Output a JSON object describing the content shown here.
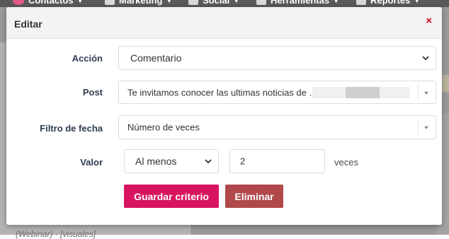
{
  "background": {
    "nav": {
      "items": [
        {
          "label": "Contactos",
          "icon": "contacts-icon"
        },
        {
          "label": "Marketing",
          "icon": "marketing-icon"
        },
        {
          "label": "Social",
          "icon": "chat-icon"
        },
        {
          "label": "Herramientas",
          "icon": "tools-icon"
        },
        {
          "label": "Reportes",
          "icon": "chart-icon"
        }
      ]
    },
    "left_text": "(Webinar) · [visuales]"
  },
  "modal": {
    "title": "Editar",
    "close_label": "×",
    "fields": {
      "accion": {
        "label": "Acción",
        "value": "Comentario"
      },
      "post": {
        "label": "Post",
        "value": "Te invitamos conocer las ultimas noticias de ."
      },
      "filtro": {
        "label": "Filtro de fecha",
        "value": "Número de veces"
      },
      "valor": {
        "label": "Valor",
        "operator": "Al menos",
        "amount": "2",
        "suffix": "veces"
      }
    },
    "buttons": {
      "save": "Guardar criterio",
      "delete": "Eliminar"
    },
    "colors": {
      "close": "#d0021b",
      "save_button": "#d9145e",
      "delete_button": "#b0484c"
    }
  }
}
